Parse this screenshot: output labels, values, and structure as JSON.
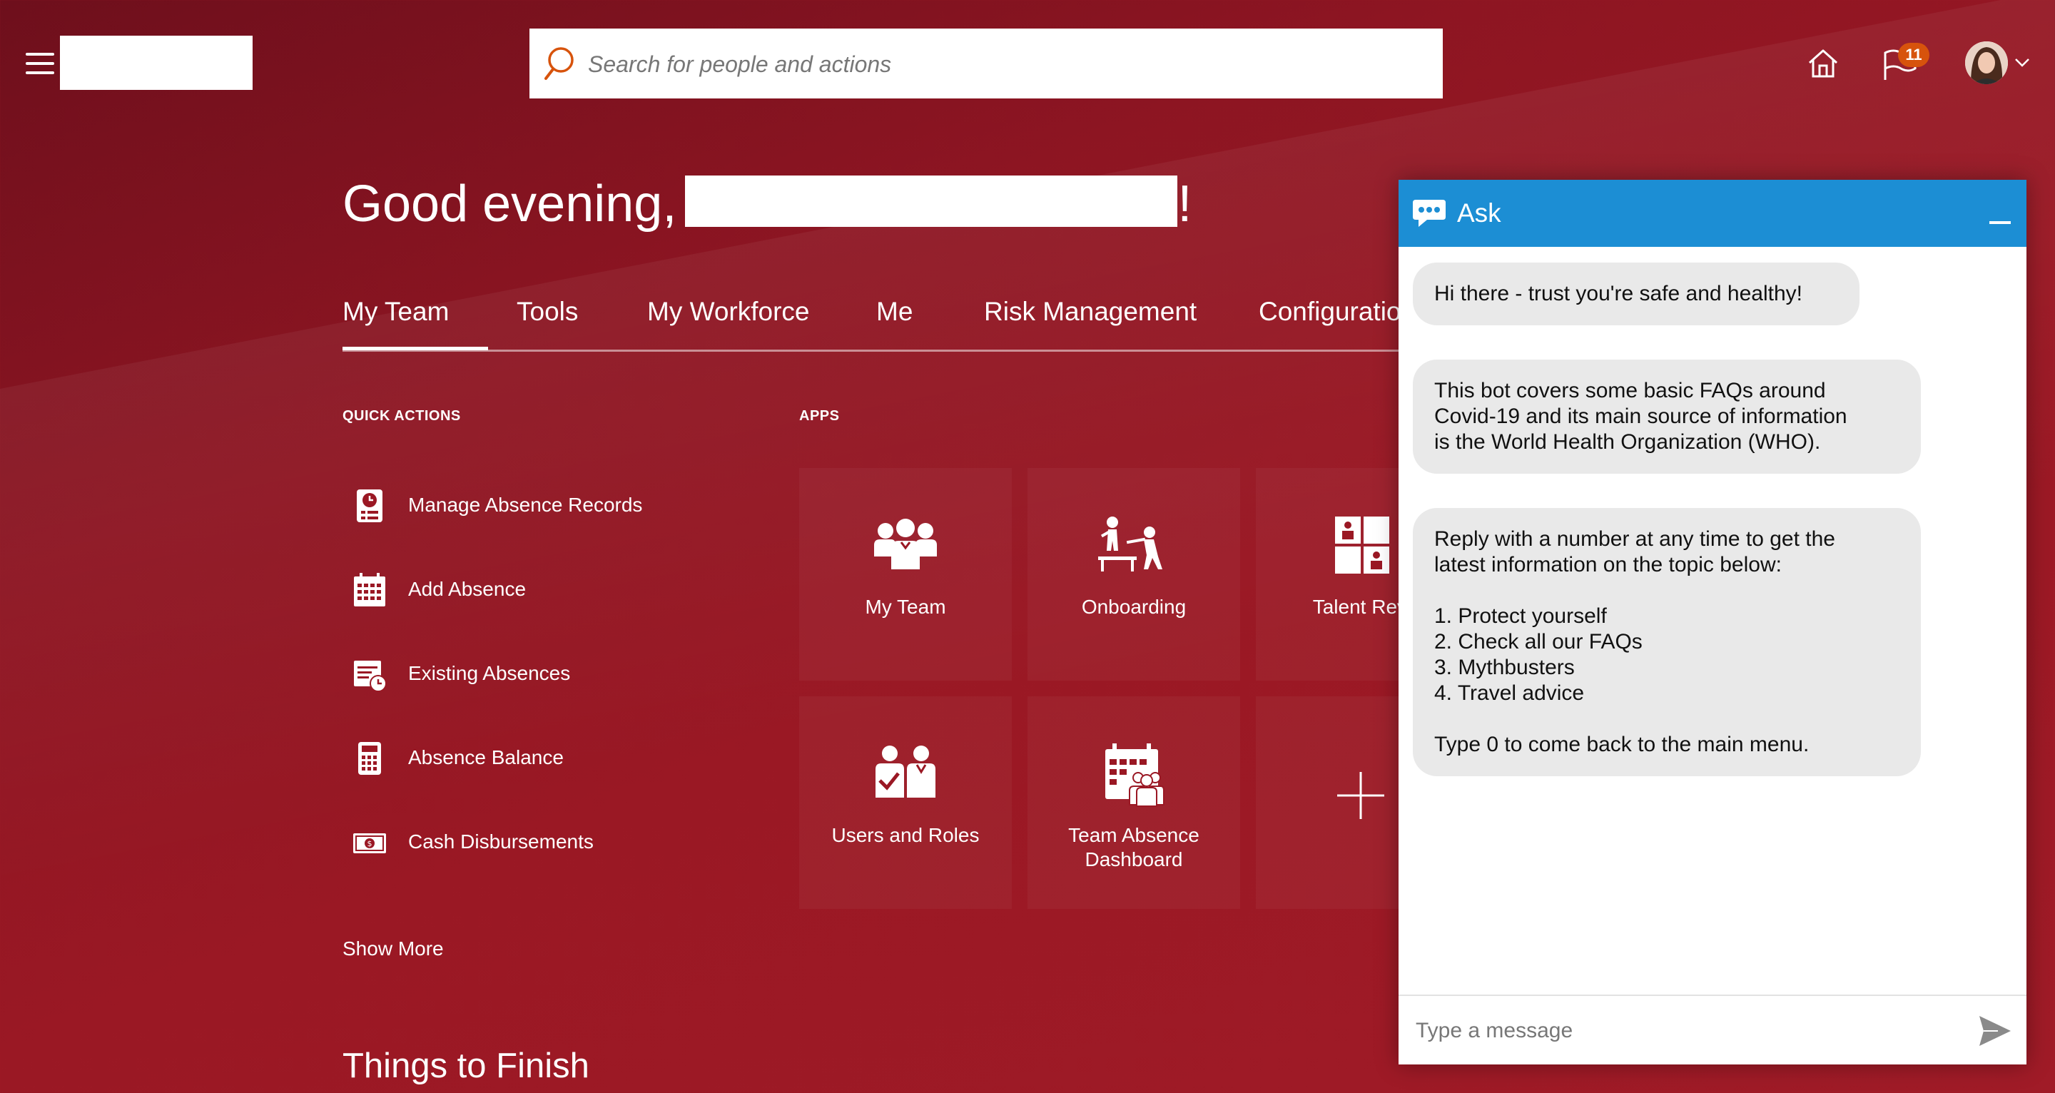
{
  "header": {
    "search_placeholder": "Search for people and actions",
    "notification_count": "11"
  },
  "greeting": {
    "prefix": "Good evening,",
    "suffix": "!"
  },
  "tabs": [
    {
      "label": "My Team",
      "active": true
    },
    {
      "label": "Tools"
    },
    {
      "label": "My Workforce"
    },
    {
      "label": "Me"
    },
    {
      "label": "Risk Management"
    },
    {
      "label": "Configuratio"
    }
  ],
  "quick_actions": {
    "title": "QUICK ACTIONS",
    "items": [
      {
        "label": "Manage Absence Records",
        "icon": "absence-record-icon"
      },
      {
        "label": "Add Absence",
        "icon": "calendar-icon"
      },
      {
        "label": "Existing Absences",
        "icon": "calendar-clock-icon"
      },
      {
        "label": "Absence Balance",
        "icon": "calculator-icon"
      },
      {
        "label": "Cash Disbursements",
        "icon": "cash-icon"
      }
    ],
    "show_more": "Show More"
  },
  "apps": {
    "title": "APPS",
    "tiles": [
      {
        "label": "My Team",
        "icon": "team-icon"
      },
      {
        "label": "Onboarding",
        "icon": "onboarding-icon"
      },
      {
        "label": "Talent Revi",
        "icon": "talent-review-icon"
      },
      {
        "label": "Users and Roles",
        "icon": "users-roles-icon"
      },
      {
        "label": "Team Absence",
        "label2": "Dashboard",
        "icon": "team-absence-icon"
      },
      {
        "icon": "plus-icon"
      }
    ]
  },
  "things_to_finish": "Things to Finish",
  "chat": {
    "title": "Ask",
    "messages": {
      "m1": "Hi there - trust you're safe and healthy!",
      "m2": [
        "This bot covers some basic FAQs around",
        "Covid-19 and its main source of information",
        "is the World Health Organization (WHO)."
      ],
      "m3": [
        "Reply with a number at any time to get the",
        "latest information on the topic below:",
        "1. Protect yourself",
        "2. Check all our FAQs",
        "3. Mythbusters",
        "4. Travel advice",
        "Type 0 to come back to the main menu."
      ]
    },
    "input_placeholder": "Type a message"
  },
  "colors": {
    "brand_red": "#9a1824",
    "chat_blue": "#1c8ed4",
    "badge_orange": "#d7530c",
    "search_icon": "#d7530c"
  }
}
